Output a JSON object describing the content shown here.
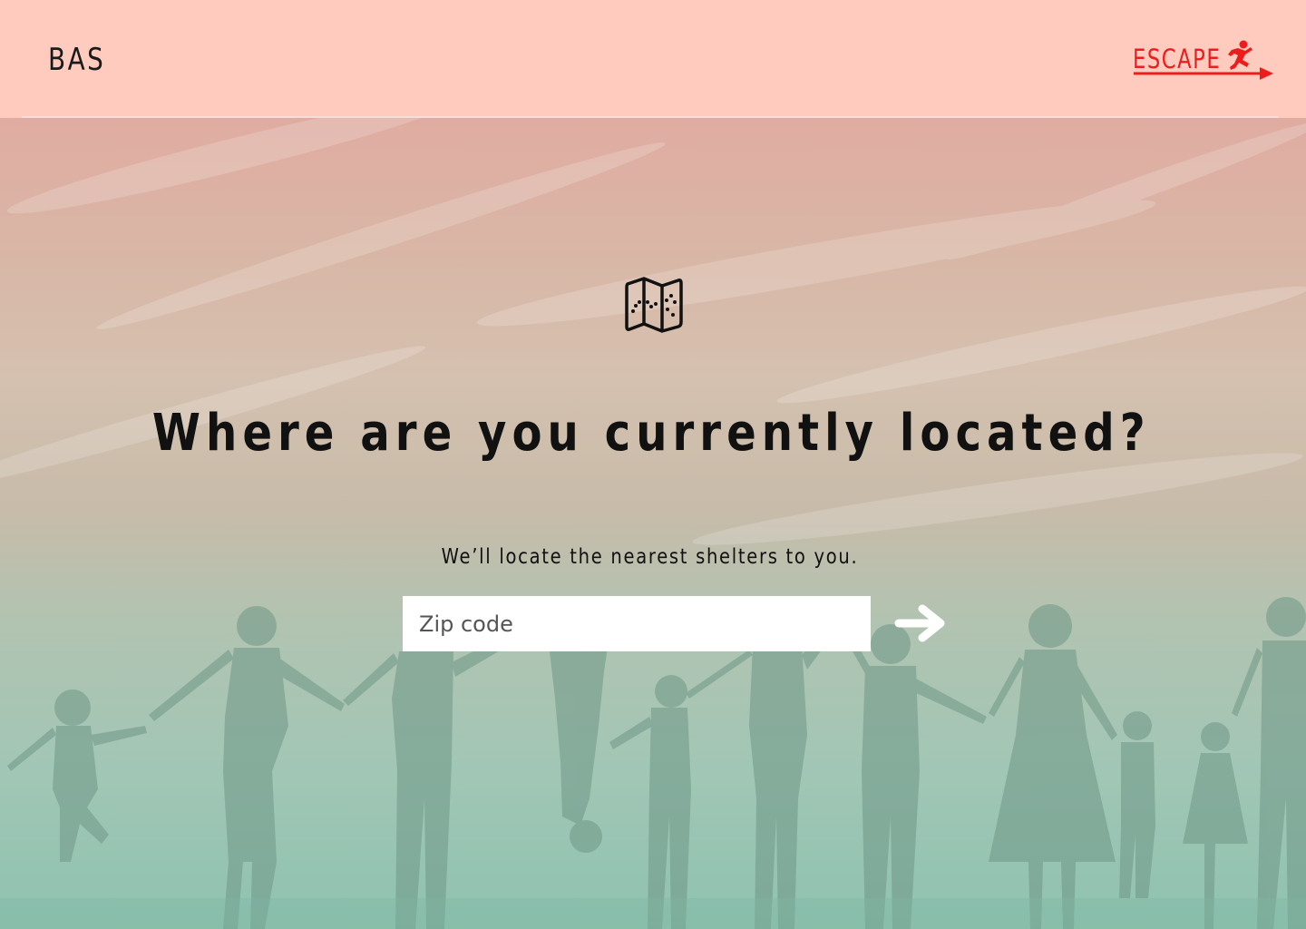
{
  "header": {
    "logo": "BAS",
    "escape_label": "ESCAPE",
    "escape_color": "#ee1d1d",
    "background": "#ffcbbe"
  },
  "main": {
    "icon": "map-icon",
    "headline": "Where are you currently located?",
    "subline": "We’ll locate the nearest shelters to you.",
    "zip_placeholder": "Zip code",
    "zip_value": "",
    "submit_icon": "arrow-right-icon"
  }
}
